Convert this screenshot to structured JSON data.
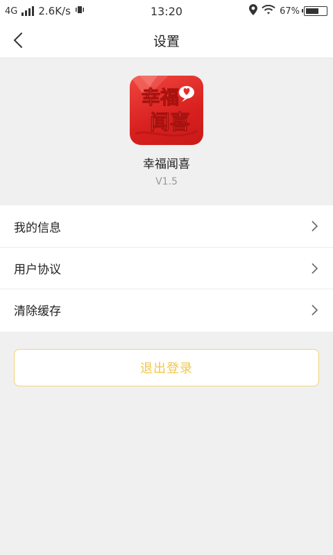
{
  "status_bar": {
    "network": "4G",
    "speed": "2.6K/s",
    "time": "13:20",
    "battery": "67%",
    "battery_level": 0.67
  },
  "nav": {
    "title": "设置"
  },
  "app": {
    "logo_text_line1": "幸福",
    "logo_text_line2": "闻喜",
    "name": "幸福闻喜",
    "version": "V1.5"
  },
  "menu": {
    "items": [
      {
        "label": "我的信息"
      },
      {
        "label": "用户协议"
      },
      {
        "label": "清除缓存"
      }
    ]
  },
  "logout": {
    "label": "退出登录"
  },
  "colors": {
    "accent": "#f1c74a",
    "logo_red": "#e0302a",
    "background": "#f0f0f0"
  }
}
